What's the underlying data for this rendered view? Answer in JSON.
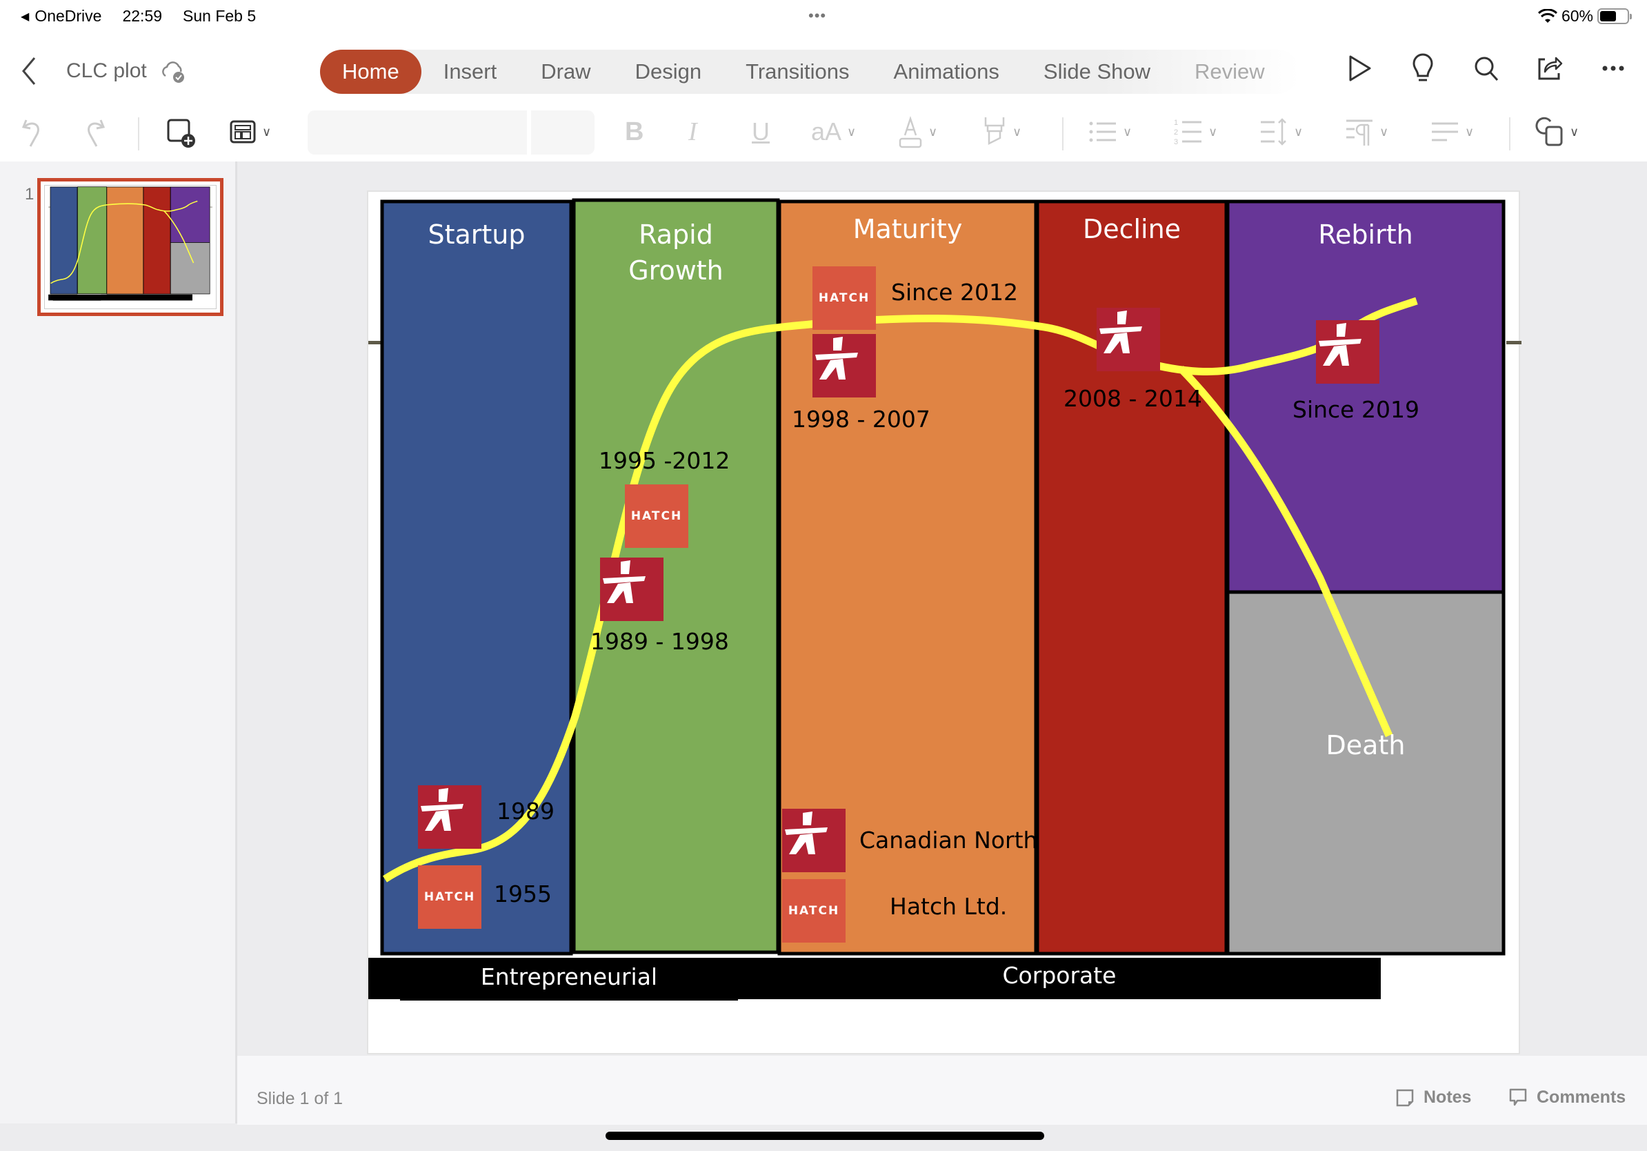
{
  "status_bar": {
    "back_app": "OneDrive",
    "time": "22:59",
    "date": "Sun Feb 5",
    "battery": "60%",
    "battery_level": 0.6
  },
  "header": {
    "doc_title": "CLC plot",
    "tabs": [
      {
        "label": "Home",
        "active": true
      },
      {
        "label": "Insert"
      },
      {
        "label": "Draw"
      },
      {
        "label": "Design"
      },
      {
        "label": "Transitions"
      },
      {
        "label": "Animations"
      },
      {
        "label": "Slide Show"
      },
      {
        "label": "Review"
      }
    ],
    "right_icons": [
      "play-icon",
      "lightbulb-icon",
      "search-icon",
      "share-icon",
      "more-icon"
    ]
  },
  "ribbon": {
    "font_name": "",
    "font_size": "",
    "bold": "B",
    "italic": "I",
    "underline": "U",
    "font_size_glyph": "aA",
    "font_color_glyph": "A"
  },
  "thumbnails": [
    {
      "number": "1",
      "selected": true
    }
  ],
  "slide": {
    "stages": [
      {
        "title": "Startup",
        "color": "#39558f"
      },
      {
        "title": "Rapid Growth",
        "color": "#7ead57"
      },
      {
        "title": "Maturity",
        "color": "#e08444"
      },
      {
        "title": "Decline",
        "color": "#ae2419"
      },
      {
        "title": "Rebirth",
        "color": "#673697"
      },
      {
        "title": "Death",
        "color": "#a6a6a6"
      }
    ],
    "labels": {
      "startup_cn": "1989",
      "startup_hatch": "1955",
      "growth_hatch": "1995 -2012",
      "growth_cn": "1989 - 1998",
      "maturity_hatch": "Since 2012",
      "maturity_cn": "1998 - 2007",
      "decline_cn": "2008 - 2014",
      "rebirth_cn": "Since 2019",
      "legend_cn": "Canadian North",
      "legend_hatch": "Hatch Ltd."
    },
    "logo_text": {
      "hatch": "HATCH"
    },
    "bands": {
      "entrepreneurial": "Entrepreneurial",
      "corporate": "Corporate"
    },
    "curve_color": "#ffff44"
  },
  "footer": {
    "slide_count": "Slide 1 of 1",
    "notes": "Notes",
    "comments": "Comments"
  }
}
